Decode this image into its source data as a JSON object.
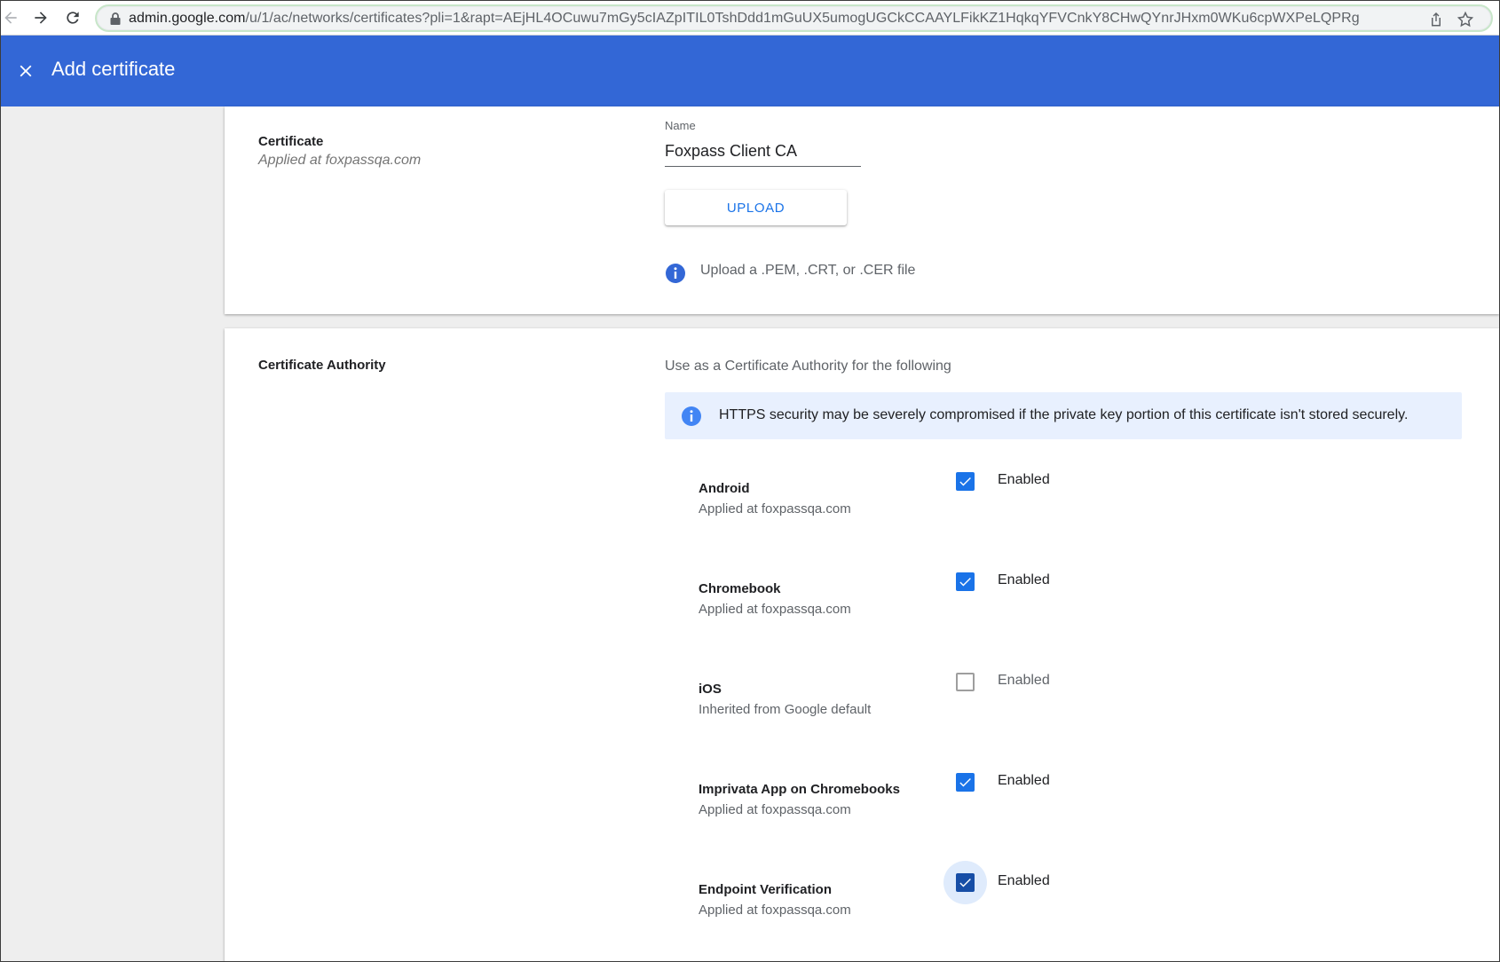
{
  "browser": {
    "url_host": "admin.google.com",
    "url_path": "/u/1/ac/networks/certificates?pli=1&rapt=AEjHL4OCuwu7mGy5cIAZpITIL0TshDdd1mGuUX5umogUGCkCCAAYLFikKZ1HqkqYFVCnkY8CHwQYnrJHxm0WKu6cpWXPeLQPRg"
  },
  "header": {
    "title": "Add certificate"
  },
  "certificate": {
    "section_title": "Certificate",
    "section_subtitle": "Applied at foxpassqa.com",
    "name_label": "Name",
    "name_value": "Foxpass Client CA",
    "upload_label": "UPLOAD",
    "hint": "Upload a .PEM, .CRT, or .CER file"
  },
  "certificate_authority": {
    "section_title": "Certificate Authority",
    "description": "Use as a Certificate Authority for the following",
    "warning": "HTTPS security may be severely compromised if the private key portion of this certificate isn't stored securely.",
    "platforms": [
      {
        "name": "Android",
        "subtitle": "Applied at foxpassqa.com",
        "enabled_label": "Enabled",
        "checked": true
      },
      {
        "name": "Chromebook",
        "subtitle": "Applied at foxpassqa.com",
        "enabled_label": "Enabled",
        "checked": true
      },
      {
        "name": "iOS",
        "subtitle": "Inherited from Google default",
        "enabled_label": "Enabled",
        "checked": false
      },
      {
        "name": "Imprivata App on Chromebooks",
        "subtitle": "Applied at foxpassqa.com",
        "enabled_label": "Enabled",
        "checked": true
      },
      {
        "name": "Endpoint Verification",
        "subtitle": "Applied at foxpassqa.com",
        "enabled_label": "Enabled",
        "checked": true
      }
    ]
  },
  "colors": {
    "header_bg": "#3367d6",
    "accent": "#1a73e8",
    "banner_bg": "#e8f0fe",
    "page_bg": "#eeeeee"
  }
}
